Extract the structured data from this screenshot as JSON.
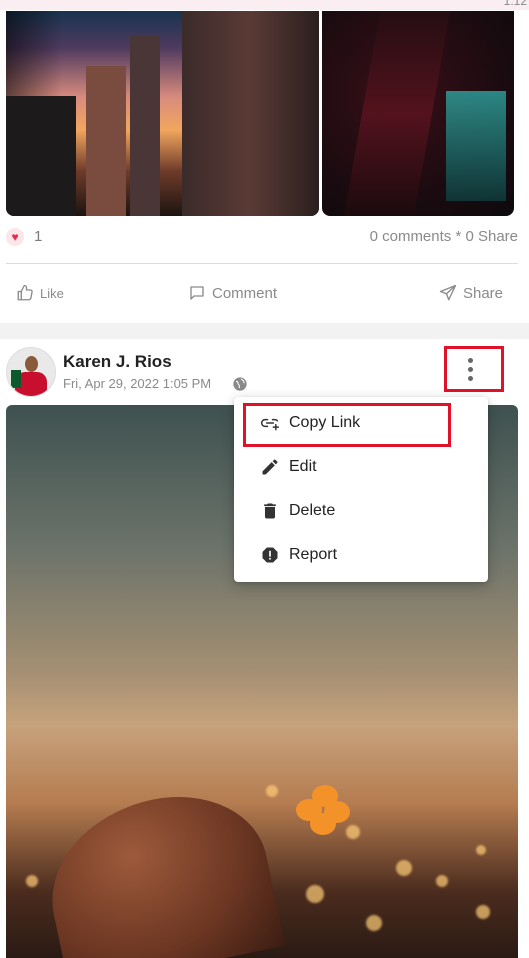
{
  "corner_text": "1:12",
  "post1": {
    "like_count": "1",
    "comments_shares": "0 comments * 0 Share",
    "actions": {
      "like": "Like",
      "comment": "Comment",
      "share": "Share"
    }
  },
  "post2": {
    "author": "Karen J. Rios",
    "date": "Fri, Apr 29, 2022 1:05 PM"
  },
  "menu": {
    "items": [
      {
        "label": "Copy Link",
        "icon": "link-icon"
      },
      {
        "label": "Edit",
        "icon": "pencil-icon"
      },
      {
        "label": "Delete",
        "icon": "trash-icon"
      },
      {
        "label": "Report",
        "icon": "alert-icon"
      }
    ]
  },
  "colors": {
    "highlight": "#e0122a",
    "heart": "#e02f4b",
    "muted_text": "#8a8a8a"
  }
}
